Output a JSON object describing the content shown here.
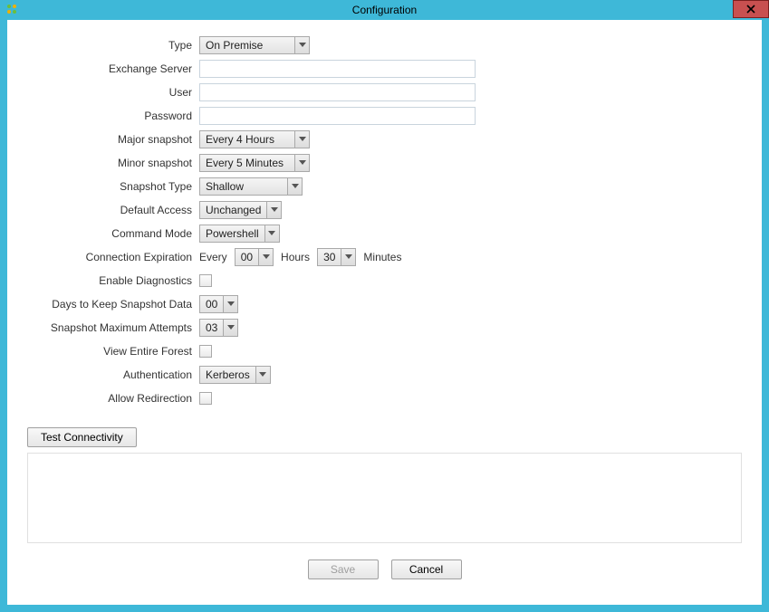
{
  "window": {
    "title": "Configuration"
  },
  "fields": {
    "type": {
      "label": "Type",
      "value": "On Premise"
    },
    "exchange_server": {
      "label": "Exchange Server",
      "value": ""
    },
    "user": {
      "label": "User",
      "value": ""
    },
    "password": {
      "label": "Password",
      "value": ""
    },
    "major_snapshot": {
      "label": "Major snapshot",
      "value": "Every 4 Hours"
    },
    "minor_snapshot": {
      "label": "Minor snapshot",
      "value": "Every 5 Minutes"
    },
    "snapshot_type": {
      "label": "Snapshot Type",
      "value": "Shallow"
    },
    "default_access": {
      "label": "Default Access",
      "value": "Unchanged"
    },
    "command_mode": {
      "label": "Command Mode",
      "value": "Powershell"
    },
    "connection_expiration": {
      "label": "Connection Expiration",
      "prefix": "Every",
      "hours_value": "00",
      "hours_label": "Hours",
      "minutes_value": "30",
      "minutes_label": "Minutes"
    },
    "enable_diagnostics": {
      "label": "Enable Diagnostics",
      "checked": false
    },
    "days_keep_snapshot": {
      "label": "Days to Keep Snapshot Data",
      "value": "00"
    },
    "snapshot_max_attempts": {
      "label": "Snapshot Maximum Attempts",
      "value": "03"
    },
    "view_entire_forest": {
      "label": "View Entire Forest",
      "checked": false
    },
    "authentication": {
      "label": "Authentication",
      "value": "Kerberos"
    },
    "allow_redirection": {
      "label": "Allow Redirection",
      "checked": false
    }
  },
  "buttons": {
    "test_connectivity": "Test Connectivity",
    "save": "Save",
    "cancel": "Cancel"
  }
}
